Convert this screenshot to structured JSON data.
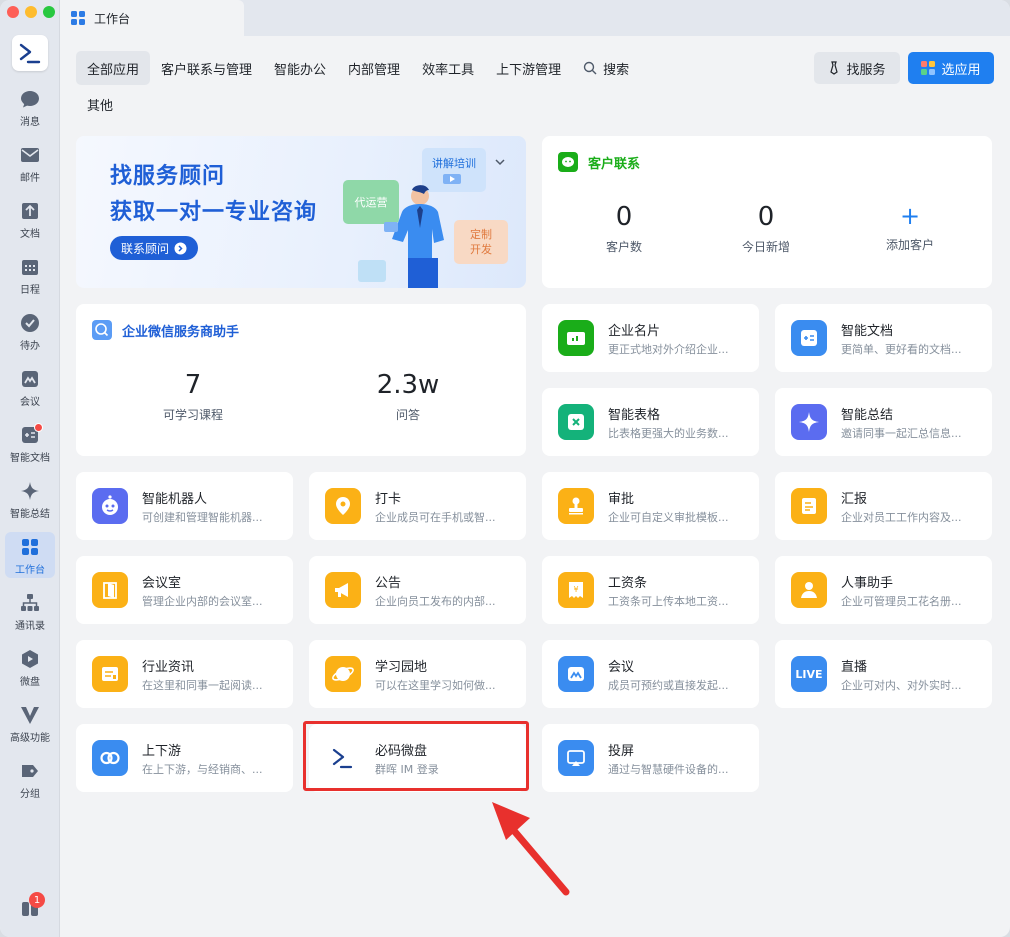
{
  "window": {
    "tab_title": "工作台"
  },
  "sidebar": {
    "items": [
      {
        "label": "消息"
      },
      {
        "label": "邮件"
      },
      {
        "label": "文档"
      },
      {
        "label": "日程"
      },
      {
        "label": "待办"
      },
      {
        "label": "会议"
      },
      {
        "label": "智能文档"
      },
      {
        "label": "智能总结"
      },
      {
        "label": "工作台"
      },
      {
        "label": "通讯录"
      },
      {
        "label": "微盘"
      },
      {
        "label": "高级功能"
      },
      {
        "label": "分组"
      }
    ],
    "bottom_badge": "1"
  },
  "categories": [
    "全部应用",
    "客户联系与管理",
    "智能办公",
    "内部管理",
    "效率工具",
    "上下游管理"
  ],
  "search_label": "搜索",
  "other_label": "其他",
  "toolbar": {
    "find_service": "找服务",
    "choose_app": "选应用"
  },
  "banner": {
    "line1": "找服务顾问",
    "line2": "获取一对一专业咨询",
    "button": "联系顾问",
    "tag_training": "讲解培训",
    "tag_operate": "代运营",
    "tag_custom": "定制开发"
  },
  "customer": {
    "title": "客户联系",
    "count_value": "0",
    "count_label": "客户数",
    "new_value": "0",
    "new_label": "今日新增",
    "add_icon": "+",
    "add_label": "添加客户"
  },
  "assistant": {
    "title": "企业微信服务商助手",
    "courses_value": "7",
    "courses_label": "可学习课程",
    "qa_value": "2.3w",
    "qa_label": "问答"
  },
  "apps": [
    {
      "name": "企业名片",
      "desc": "更正式地对外介绍企业...",
      "icon": "card-icon",
      "color": "#1aad19"
    },
    {
      "name": "智能文档",
      "desc": "更简单、更好看的文档...",
      "icon": "smart-doc-icon",
      "color": "#3a8cf0"
    },
    {
      "name": "智能表格",
      "desc": "比表格更强大的业务数...",
      "icon": "smart-sheet-icon",
      "color": "#14b27a"
    },
    {
      "name": "智能总结",
      "desc": "邀请同事一起汇总信息...",
      "icon": "sparkle-icon",
      "color": "#5b6cf0"
    },
    {
      "name": "智能机器人",
      "desc": "可创建和管理智能机器...",
      "icon": "robot-icon",
      "color": "#5b6cf0"
    },
    {
      "name": "打卡",
      "desc": "企业成员可在手机或智...",
      "icon": "location-icon",
      "color": "#fbb116"
    },
    {
      "name": "审批",
      "desc": "企业可自定义审批模板...",
      "icon": "stamp-icon",
      "color": "#fbb116"
    },
    {
      "name": "汇报",
      "desc": "企业对员工工作内容及...",
      "icon": "report-icon",
      "color": "#fbb116"
    },
    {
      "name": "会议室",
      "desc": "管理企业内部的会议室...",
      "icon": "door-icon",
      "color": "#fbb116"
    },
    {
      "name": "公告",
      "desc": "企业向员工发布的内部...",
      "icon": "megaphone-icon",
      "color": "#fbb116"
    },
    {
      "name": "工资条",
      "desc": "工资条可上传本地工资...",
      "icon": "salary-icon",
      "color": "#fbb116"
    },
    {
      "name": "人事助手",
      "desc": "企业可管理员工花名册...",
      "icon": "person-icon",
      "color": "#fbb116"
    },
    {
      "name": "行业资讯",
      "desc": "在这里和同事一起阅读...",
      "icon": "news-icon",
      "color": "#fbb116"
    },
    {
      "name": "学习园地",
      "desc": "可以在这里学习如何做...",
      "icon": "planet-icon",
      "color": "#fbb116"
    },
    {
      "name": "会议",
      "desc": "成员可预约或直接发起...",
      "icon": "meeting-icon",
      "color": "#3a8cf0"
    },
    {
      "name": "直播",
      "desc": "企业可对内、对外实时...",
      "icon": "live-icon",
      "color": "#3a8cf0",
      "icon_text": "LIVE"
    },
    {
      "name": "上下游",
      "desc": "在上下游，与经销商、...",
      "icon": "link-icon",
      "color": "#3a8cf0"
    },
    {
      "name": "必码微盘",
      "desc": "群晖 IM 登录",
      "icon": "terminal-icon",
      "color": "#ffffff"
    },
    {
      "name": "投屏",
      "desc": "通过与智慧硬件设备的...",
      "icon": "cast-icon",
      "color": "#3a8cf0"
    }
  ],
  "colors": {
    "accent": "#1f7ff0",
    "highlight": "#e8302d",
    "green": "#1aad19"
  }
}
